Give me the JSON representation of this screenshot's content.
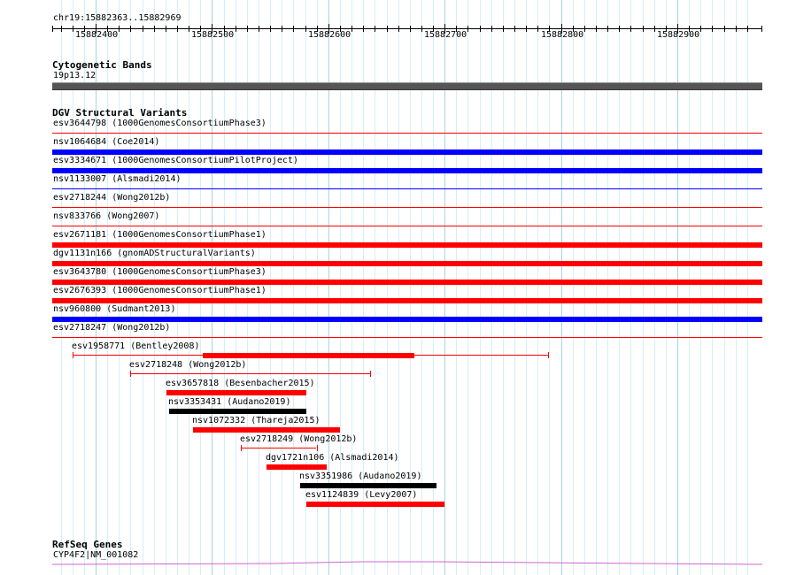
{
  "browser": {
    "location": "chr19:15882363..15882969",
    "ticks": [
      "15882400",
      "15882500",
      "15882600",
      "15882700",
      "15882800",
      "15882900"
    ]
  },
  "cytoband": {
    "title": "Cytogenetic Bands",
    "label": "19p13.12",
    "color": "#555555"
  },
  "dgv": {
    "title": "DGV Structural Variants",
    "colors": {
      "loss": "#ff0000",
      "gain": "#0000ff",
      "complex": "#000000"
    },
    "full_rows": [
      {
        "label": "esv3644798 (1000GenomesConsortiumPhase3)",
        "type": "loss",
        "bar": false
      },
      {
        "label": "nsv1064684 (Coe2014)",
        "type": "gain",
        "bar": true
      },
      {
        "label": "esv3334671 (1000GenomesConsortiumPilotProject)",
        "type": "gain",
        "bar": true
      },
      {
        "label": "nsv1133007 (Alsmadi2014)",
        "type": "gain",
        "bar": false
      },
      {
        "label": "esv2718244 (Wong2012b)",
        "type": "loss",
        "bar": false
      },
      {
        "label": "nsv833766 (Wong2007)",
        "type": "loss",
        "bar": false
      },
      {
        "label": "esv2671181 (1000GenomesConsortiumPhase1)",
        "type": "loss",
        "bar": true
      },
      {
        "label": "dgv1131n166 (gnomADStructuralVariants)",
        "type": "loss",
        "bar": true
      },
      {
        "label": "esv3643780 (1000GenomesConsortiumPhase3)",
        "type": "loss",
        "bar": true
      },
      {
        "label": "esv2676393 (1000GenomesConsortiumPhase1)",
        "type": "loss",
        "bar": true
      },
      {
        "label": "nsv960800 (Sudmant2013)",
        "type": "gain",
        "bar": true
      },
      {
        "label": "esv2718247 (Wong2012b)",
        "type": "loss",
        "bar": false
      }
    ],
    "partial": [
      {
        "label": "esv1958771 (Bentley2008)",
        "type": "loss",
        "start": 15882380,
        "end": 15882789,
        "core_start": 15882492,
        "core_end": 15882674
      },
      {
        "label": "esv2718248 (Wong2012b)",
        "type": "loss",
        "start": 15882430,
        "end": 15882636,
        "core_start": null,
        "core_end": null
      },
      {
        "label": "esv3657818 (Besenbacher2015)",
        "type": "loss",
        "start": 15882461,
        "end": 15882581,
        "core_start": 15882461,
        "core_end": 15882581
      },
      {
        "label": "nsv3353431 (Audano2019)",
        "type": "complex",
        "start": 15882463,
        "end": 15882581,
        "core_start": 15882463,
        "core_end": 15882581
      },
      {
        "label": "nsv1072332 (Thareja2015)",
        "type": "loss",
        "start": 15882484,
        "end": 15882610,
        "core_start": 15882484,
        "core_end": 15882610
      },
      {
        "label": "esv2718249 (Wong2012b)",
        "type": "loss",
        "start": 15882525,
        "end": 15882590,
        "core_start": null,
        "core_end": null
      },
      {
        "label": "dgv1721n106 (Alsmadi2014)",
        "type": "loss",
        "start": 15882547,
        "end": 15882599,
        "core_start": 15882547,
        "core_end": 15882599
      },
      {
        "label": "nsv3351986 (Audano2019)",
        "type": "complex",
        "start": 15882576,
        "end": 15882693,
        "core_start": 15882576,
        "core_end": 15882693
      },
      {
        "label": "esv1124839 (Levy2007)",
        "type": "loss",
        "start": 15882581,
        "end": 15882700,
        "core_start": 15882581,
        "core_end": 15882700
      }
    ]
  },
  "refseq": {
    "title": "RefSeq Genes",
    "label": "CYP4F2|NM_001082",
    "color": "#cc66cc"
  }
}
